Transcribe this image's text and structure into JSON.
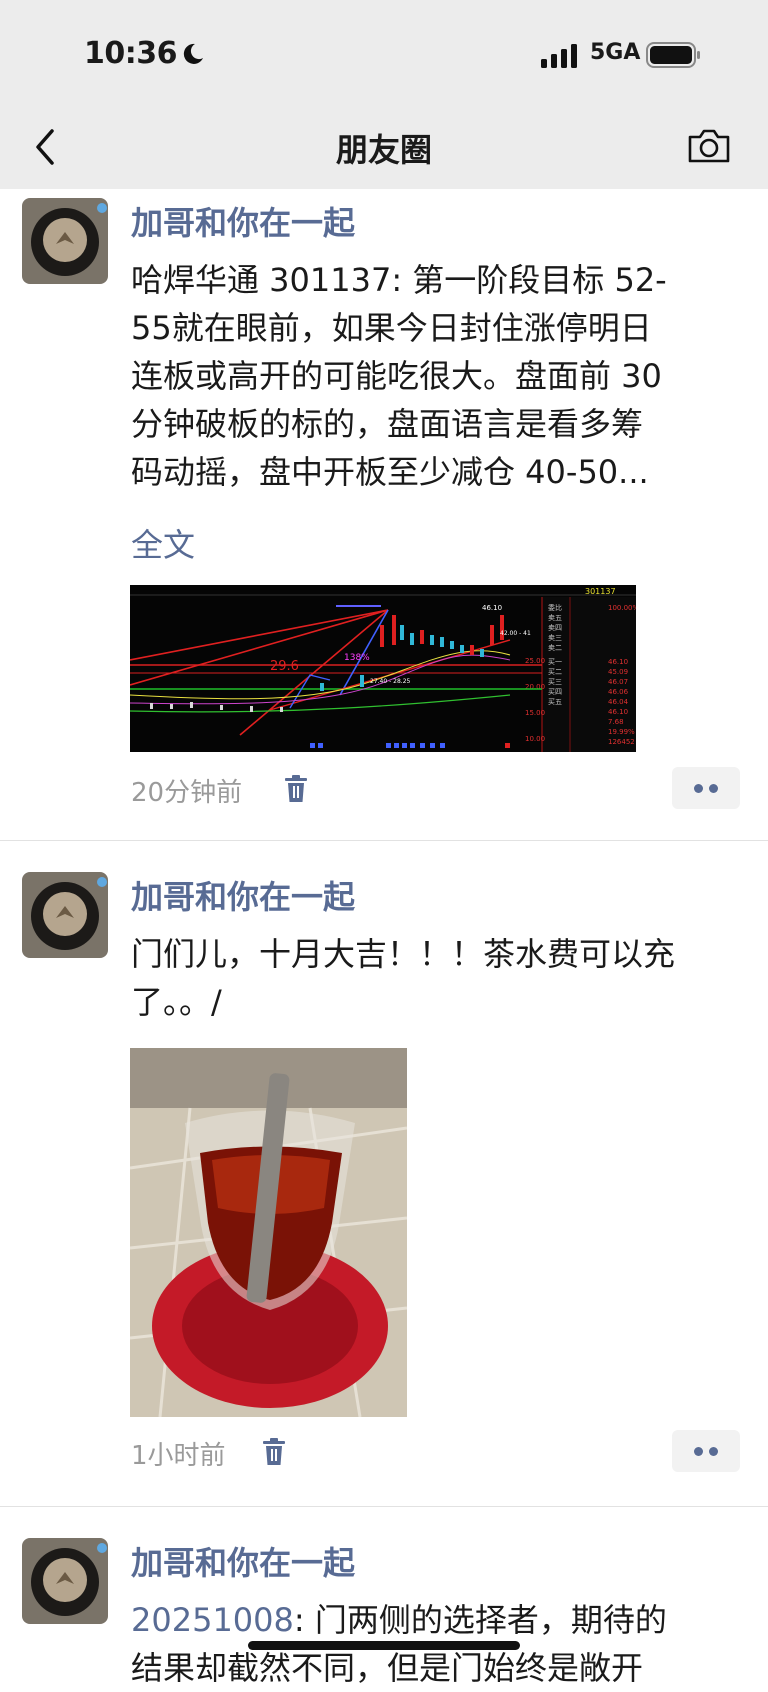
{
  "status_bar": {
    "time": "10:36",
    "network": "5GA",
    "icons": [
      "moon-icon",
      "cellular-signal-icon",
      "battery-icon"
    ]
  },
  "nav": {
    "title": "朋友圈",
    "back_icon": "chevron-left-icon",
    "camera_icon": "camera-icon"
  },
  "posts": [
    {
      "author": "加哥和你在一起",
      "content_lines": [
        "哈焊华通 301137: 第一阶段目标 52-",
        "55就在眼前，如果今日封住涨停明日",
        "连板或高开的可能吃很大。盘面前 30",
        "分钟破板的标的，盘面语言是看多筹",
        "码动摇，盘中开板至少减仓 40-50..."
      ],
      "full_text_label": "全文",
      "image": {
        "type": "stock-chart-screenshot",
        "stock_code": "301137",
        "labels": [
          "29.6",
          "138%",
          "46.10",
          "42.00 - 41",
          "27.40 - 28.25",
          "25.00",
          "20.00",
          "15.00",
          "10.00"
        ]
      },
      "time": "20分钟前"
    },
    {
      "author": "加哥和你在一起",
      "content_lines": [
        "门们儿，十月大吉！！！茶水费可以充",
        "了。。/"
      ],
      "image": {
        "type": "photo",
        "subject": "tea glass on red saucer"
      },
      "time": "1小时前"
    },
    {
      "author": "加哥和你在一起",
      "date_link": "20251008",
      "content_lines": [
        ": 门两侧的选择者，期待的",
        "结果却截然不同，但是门始终是敞开"
      ]
    }
  ],
  "colors": {
    "author": "#586b94",
    "link": "#586b94",
    "meta": "#9a9a9a",
    "bar_bg": "#ececec"
  }
}
